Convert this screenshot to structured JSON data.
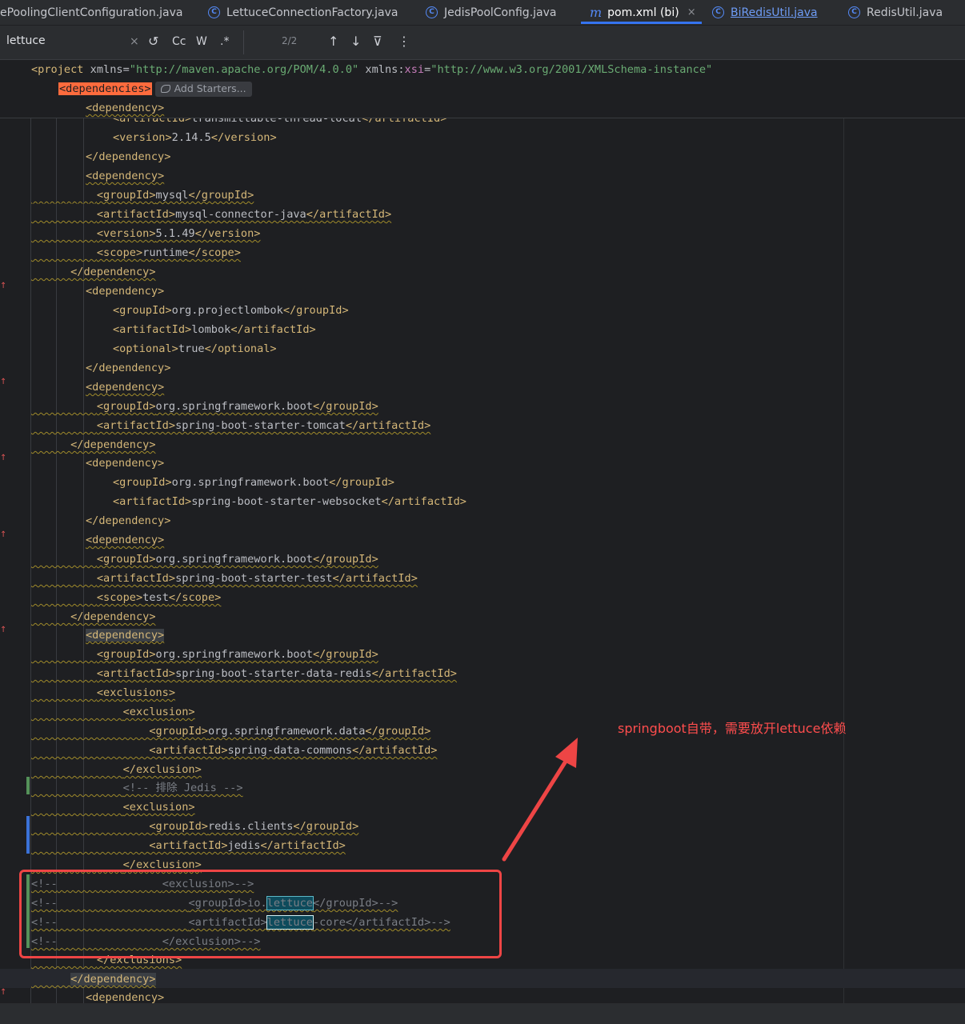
{
  "tabs": [
    {
      "label": "ePoolingClientConfiguration.java",
      "icon": "none",
      "state": "normal"
    },
    {
      "label": "LettuceConnectionFactory.java",
      "icon": "class-icon",
      "state": "normal"
    },
    {
      "label": "JedisPoolConfig.java",
      "icon": "class-icon",
      "state": "normal"
    },
    {
      "label": "pom.xml (bi)",
      "icon": "maven-icon",
      "state": "active"
    },
    {
      "label": "BiRedisUtil.java",
      "icon": "class-icon",
      "state": "link"
    },
    {
      "label": "RedisUtil.java",
      "icon": "class-icon",
      "state": "normal"
    }
  ],
  "tab_icon_glyphs": {
    "class": "C",
    "maven": "m",
    "close": "×"
  },
  "search": {
    "query": "lettuce",
    "match_count": "2/2",
    "clear_glyph": "×",
    "replace_glyph": "↺",
    "case_label": "Cc",
    "word_label": "W",
    "regex_label": ".*",
    "prev_glyph": "↑",
    "next_glyph": "↓",
    "filter_glyph": "⊽",
    "more_glyph": "⋮"
  },
  "sticky": {
    "project_tag_open": "<project",
    "xmlns_attr": "xmlns",
    "xmlns_value": "\"http://maven.apache.org/POM/4.0.0\"",
    "xsi_prefix": "xmlns:",
    "xsi_name": "xsi",
    "xsi_value": "\"http://www.w3.org/2001/XMLSchema-instance\"",
    "dependencies_tag": "<dependencies>",
    "add_starters": "Add Starters..."
  },
  "code": {
    "l1a": "<artifactId>",
    "l1b": "transmittable-thread-local",
    "l1c": "</artifactId>",
    "l2a": "<version>",
    "l2b": "2.14.5",
    "l2c": "</version>",
    "dep_open": "<dependency>",
    "dep_close": "</dependency>",
    "group_open": "<groupId>",
    "group_close": "</groupId>",
    "artifact_open": "<artifactId>",
    "artifact_close": "</artifactId>",
    "version_open": "<version>",
    "version_close": "</version>",
    "scope_open": "<scope>",
    "scope_close": "</scope>",
    "optional_open": "<optional>",
    "optional_close": "</optional>",
    "exclusions_open": "<exclusions>",
    "exclusions_close": "</exclusions>",
    "exclusion_open": "<exclusion>",
    "exclusion_close": "</exclusion>",
    "mysql": "mysql",
    "mysql_connector": "mysql-connector-java",
    "mysql_version": "5.1.49",
    "runtime": "runtime",
    "lombok_group": "org.projectlombok",
    "lombok": "lombok",
    "true_val": "true",
    "sf_boot": "org.springframework.boot",
    "starter_tomcat": "spring-boot-starter-tomcat",
    "starter_websocket": "spring-boot-starter-websocket",
    "starter_test": "spring-boot-starter-test",
    "test": "test",
    "starter_redis": "spring-boot-starter-data-redis",
    "sf_data": "org.springframework.data",
    "data_commons": "spring-data-commons",
    "comment_jedis": "<!-- 排除 Jedis -->",
    "redis_clients": "redis.clients",
    "jedis": "jedis",
    "cmt_prefix": "<!--",
    "cmt_excl_open": "<exclusion>-->",
    "cmt_group_a": "<groupId>io.",
    "lettuce": "lettuce",
    "cmt_group_c": "</groupId>-->",
    "cmt_art_a": "<artifactId>",
    "cmt_art_c": "-core</artifactId>-->",
    "cmt_excl_close": "</exclusion>-->"
  },
  "annotation": {
    "text": "springboot自带，需要放开lettuce依赖",
    "color": "#ee4545"
  },
  "gutter_marker": "↑"
}
